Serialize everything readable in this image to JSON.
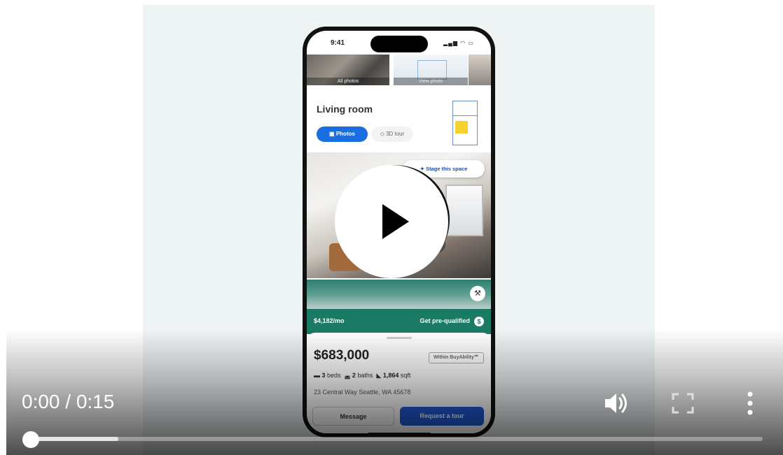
{
  "player": {
    "time_display": "0:00 / 0:15",
    "current_time": "0:00",
    "duration": "0:15",
    "progress_fraction": 0.0,
    "buffered_fraction": 0.12,
    "icons": {
      "play": "play-icon",
      "volume": "volume-icon",
      "fullscreen": "fullscreen-icon",
      "more": "more-vert-icon"
    }
  },
  "video_frame": {
    "status_time": "9:41",
    "thumbs": [
      "All photos",
      "View photo"
    ],
    "room_title": "Living room",
    "tabs": [
      "Photos",
      "3D tour"
    ],
    "stage_button": "Stage this space",
    "monthly": "$4,182/mo",
    "prequalify": "Get pre-qualified",
    "price": "$683,000",
    "buy_badge": "Within BuyAbility℠",
    "beds": "3",
    "beds_label": "beds",
    "baths": "2",
    "baths_label": "baths",
    "sqft": "1,864",
    "sqft_label": "sqft",
    "address": "23 Central Way Seattle, WA 45678",
    "message_button": "Message",
    "tour_button": "Request a tour",
    "colors": {
      "primary_blue": "#1f5bd6",
      "green_bar": "#1a7a64",
      "highlight_yellow": "#f5d230"
    }
  }
}
